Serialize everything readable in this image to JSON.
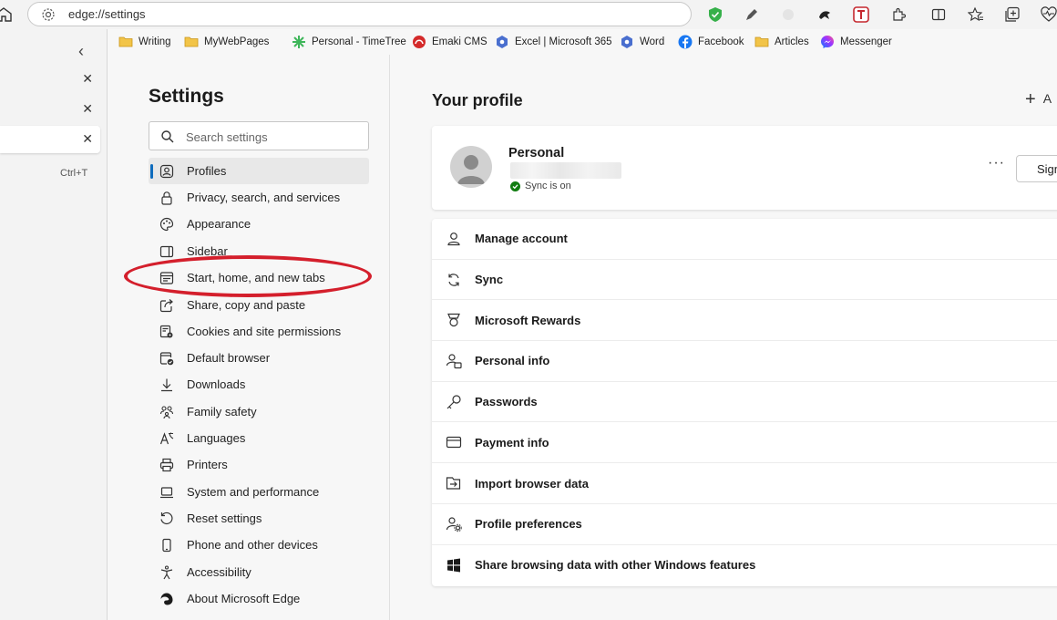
{
  "address_bar": {
    "url": "edge://settings"
  },
  "bookmarks": [
    {
      "label": "Writing",
      "icon": "folder-icon"
    },
    {
      "label": "MyWebPages",
      "icon": "folder-icon"
    },
    {
      "label": "Personal - TimeTree",
      "icon": "timetree-icon"
    },
    {
      "label": "Emaki CMS",
      "icon": "emaki-icon"
    },
    {
      "label": "Excel | Microsoft 365",
      "icon": "excel-icon"
    },
    {
      "label": "Word",
      "icon": "word-icon"
    },
    {
      "label": "Facebook",
      "icon": "facebook-icon"
    },
    {
      "label": "Articles",
      "icon": "folder-icon"
    },
    {
      "label": "Messenger",
      "icon": "messenger-icon"
    }
  ],
  "tab_panel": {
    "shortcut": "Ctrl+T"
  },
  "nav": {
    "title": "Settings",
    "search_placeholder": "Search settings",
    "items": [
      {
        "label": "Profiles",
        "icon": "profile-icon",
        "active": true
      },
      {
        "label": "Privacy, search, and services",
        "icon": "lock-icon"
      },
      {
        "label": "Appearance",
        "icon": "palette-icon"
      },
      {
        "label": "Sidebar",
        "icon": "sidebar-icon"
      },
      {
        "label": "Start, home, and new tabs",
        "icon": "home-tabs-icon"
      },
      {
        "label": "Share, copy and paste",
        "icon": "share-icon"
      },
      {
        "label": "Cookies and site permissions",
        "icon": "cookies-icon"
      },
      {
        "label": "Default browser",
        "icon": "browser-icon"
      },
      {
        "label": "Downloads",
        "icon": "download-icon"
      },
      {
        "label": "Family safety",
        "icon": "family-icon"
      },
      {
        "label": "Languages",
        "icon": "language-icon"
      },
      {
        "label": "Printers",
        "icon": "printer-icon"
      },
      {
        "label": "System and performance",
        "icon": "laptop-icon"
      },
      {
        "label": "Reset settings",
        "icon": "reset-icon"
      },
      {
        "label": "Phone and other devices",
        "icon": "phone-icon"
      },
      {
        "label": "Accessibility",
        "icon": "accessibility-icon"
      },
      {
        "label": "About Microsoft Edge",
        "icon": "edge-icon"
      }
    ]
  },
  "main": {
    "title": "Your profile",
    "add_label": "A",
    "profile": {
      "name": "Personal",
      "sync_status": "Sync is on",
      "more_label": "···",
      "sign_label": "Sign"
    },
    "rows": [
      {
        "label": "Manage account",
        "icon": "person-icon"
      },
      {
        "label": "Sync",
        "icon": "sync-icon"
      },
      {
        "label": "Microsoft Rewards",
        "icon": "rewards-icon"
      },
      {
        "label": "Personal info",
        "icon": "personal-info-icon"
      },
      {
        "label": "Passwords",
        "icon": "key-icon"
      },
      {
        "label": "Payment info",
        "icon": "card-icon"
      },
      {
        "label": "Import browser data",
        "icon": "import-icon"
      },
      {
        "label": "Profile preferences",
        "icon": "profile-prefs-icon"
      },
      {
        "label": "Share browsing data with other Windows features",
        "icon": "windows-icon"
      }
    ]
  },
  "colors": {
    "accent": "#0f6cbd",
    "annotation": "#d41f2c",
    "sync_ok": "#107c10"
  }
}
